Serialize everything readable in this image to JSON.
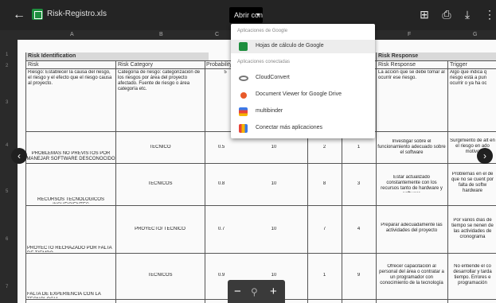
{
  "topbar": {
    "back": "←",
    "file_title": "Risk-Registro.xls",
    "open_with_label": "Abrir con",
    "open_with_chevron": "▾",
    "icons": {
      "comment": "⊞",
      "print": "⎙",
      "download": "⤓",
      "more": "⋮"
    }
  },
  "sheet": {
    "columns": [
      "A",
      "B",
      "C",
      "D",
      "E",
      "F",
      "G"
    ],
    "rows": [
      "1",
      "2",
      "3",
      "4",
      "5",
      "6",
      "7"
    ],
    "section_left": "Risk Identification",
    "section_right": "Risk Response",
    "headers": {
      "risk": "Risk",
      "category": "Risk Category",
      "probability": "Probability",
      "response": "Risk Response",
      "trigger": "Trigger"
    },
    "row_desc": {
      "risk": "Riesgo: Establecer la causa del riesgo, el riesgo y el efecto que el riesgo causa al proyecto.",
      "category": "Categoría de riesgo: categorización de los riesgos por área del proyecto afectado. Fuente de riesgo o área categoría etc.",
      "probability": "5",
      "response": "La acción que se debe tomar al ocurrir ese riesgo.",
      "trigger": "Algo que indica q riesgo está a pun ocurrir o ya ha oc"
    },
    "rows_data": [
      {
        "risk": "PROBLEMAS NO PREVISTOS POR MANEJAR SOFTWARE DESCONOCIDO",
        "category": "TECNICO",
        "probability": "0.5",
        "impact": "10",
        "score": "2",
        "rank": "1",
        "response": "Investigar sobre el funcionamiento adecuado sobre el software",
        "trigger": "Surgimiento de alt en el riesgo en ado motivo"
      },
      {
        "risk": "RECURSOS TECNOLOGICOS INSUFICIENTES",
        "category": "TECNICOS",
        "probability": "0.8",
        "impact": "10",
        "score": "8",
        "rank": "3",
        "response": "Estar actualizado constantemente con los recursos tanto de hardware y software",
        "trigger": "Problemas en el de que no se cuent por falta de softw hardware"
      },
      {
        "risk": "PROYECTO RECHAZADO POR FALTA DE TIEMPO",
        "category": "PROYECTO/ TECNICO",
        "probability": "0.7",
        "impact": "10",
        "score": "7",
        "rank": "4",
        "response": "Preparar adecuadamente las actividades del proyecto",
        "trigger": "Por varios días de tiempo se nenen de las actividades de cronograma"
      },
      {
        "risk": "FALTA DE EXPERIENCIA CON LA TECNOLOGIA",
        "category": "TECNICOS",
        "probability": "0.9",
        "impact": "10",
        "score": "1",
        "rank": "9",
        "response": "Ofrecer capacitación al personal del área o contratar a un programador con conocimiento de la tecnología",
        "trigger": "No entiende el co desarrollar y tarda tiempo. Errores e programación"
      }
    ]
  },
  "nav": {
    "prev": "‹",
    "next": "›"
  },
  "zoom": {
    "minus": "−",
    "search": "⚲",
    "plus": "+"
  },
  "dropdown": {
    "section_google": "Aplicaciones de Google",
    "google_items": [
      {
        "label": "Hojas de cálculo de Google",
        "icon": "sheets-icon"
      }
    ],
    "section_connected": "Aplicaciones conectadas",
    "connected_items": [
      {
        "label": "CloudConvert",
        "icon": "cloudconvert-icon"
      },
      {
        "label": "Document Viewer for Google Drive",
        "icon": "document-viewer-icon"
      },
      {
        "label": "multibinder",
        "icon": "multibinder-icon"
      },
      {
        "label": "Conectar más aplicaciones",
        "icon": "connect-apps-icon"
      }
    ]
  }
}
